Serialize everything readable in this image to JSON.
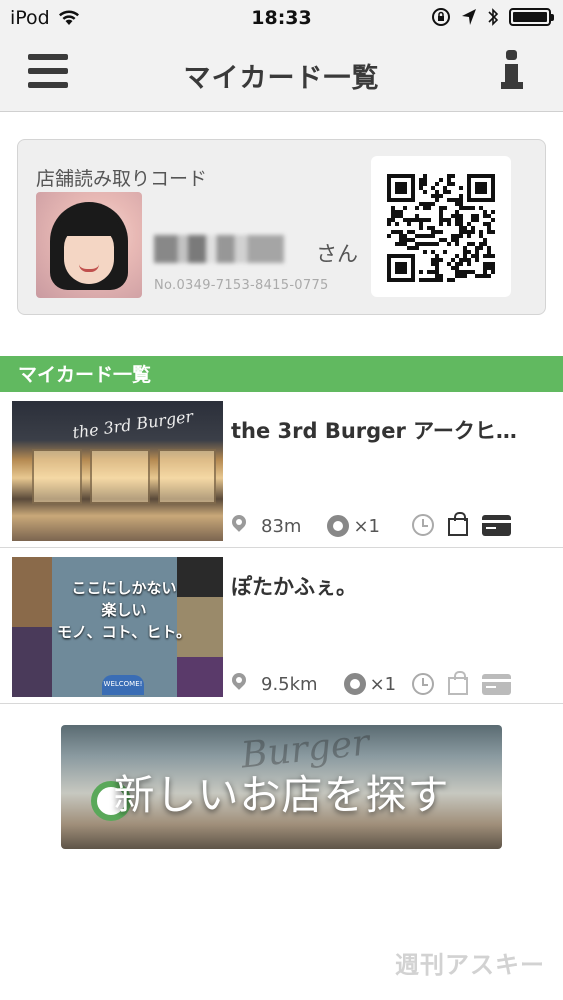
{
  "status_bar": {
    "carrier": "iPod",
    "time": "18:33",
    "battery_level": 1.0
  },
  "nav": {
    "title": "マイカード一覧"
  },
  "member_card": {
    "label": "店舗読み取りコード",
    "name_suffix": "さん",
    "member_number": "No.0349-7153-8415-0775"
  },
  "section": {
    "title": "マイカード一覧"
  },
  "stores": [
    {
      "name": "the 3rd Burger アークヒ…",
      "distance": "83m",
      "stamp_count": "×1",
      "thumb_sign": "the 3rd Burger",
      "icons_active": true
    },
    {
      "name": "ぽたかふぇ。",
      "distance": "9.5km",
      "stamp_count": "×1",
      "thumb_caption_1": "ここにしかない",
      "thumb_caption_2": "楽しい",
      "thumb_caption_3": "モノ、コト、ヒト。",
      "thumb_badge": "WELCOME!",
      "icons_active": false
    }
  ],
  "banner": {
    "text": "新しいお店を探す",
    "bg_sign": "Burger"
  },
  "watermark": "週刊アスキー",
  "colors": {
    "accent_green": "#61b960",
    "nav_bg": "#f2f2f2",
    "card_bg": "#efefef"
  }
}
